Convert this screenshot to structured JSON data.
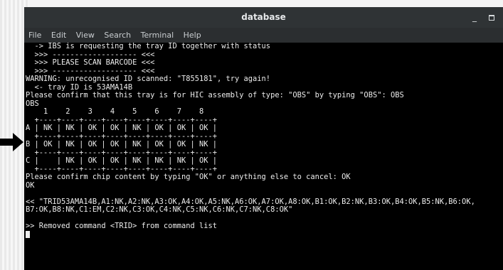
{
  "window": {
    "title": "database",
    "minimize_glyph": "_",
    "maximize_icon": "maximize-icon"
  },
  "menu": {
    "items": [
      "File",
      "Edit",
      "View",
      "Search",
      "Terminal",
      "Help"
    ]
  },
  "terminal": {
    "lines": [
      "  -> IBS is requesting the tray ID together with status",
      "  >>> ------------------- <<<",
      "  >>> PLEASE SCAN BARCODE <<<",
      "  >>> ------------------- <<<",
      "WARNING: unrecognised ID scanned: \"T855181\", try again!",
      "  <- tray ID is 53AMA14B",
      "Please confirm that this tray is for HIC assembly of type: \"OBS\" by typing \"OBS\": OBS",
      "OBS",
      "    1    2    3    4    5    6    7    8",
      "  +----+----+----+----+----+----+----+----+",
      "A | NK | NK | OK | OK | NK | OK | OK | OK |",
      "  +----+----+----+----+----+----+----+----+",
      "B | OK | NK | OK | OK | NK | OK | OK | NK |",
      "  +----+----+----+----+----+----+----+----+",
      "C |    | NK | OK | OK | NK | NK | NK | OK |",
      "  +----+----+----+----+----+----+----+----+",
      "Please confirm chip content by typing \"OK\" or anything else to cancel: OK",
      "OK",
      "",
      "<< \"TRID53AMA14B,A1:NK,A2:NK,A3:OK,A4:OK,A5:NK,A6:OK,A7:OK,A8:OK,B1:OK,B2:NK,B3:OK,B4:OK,B5:NK,B6:OK,",
      "B7:OK,B8:NK,C1:EM,C2:NK,C3:OK,C4:NK,C5:NK,C6:NK,C7:NK,C8:OK\"",
      "",
      ">> Removed command <TRID> from command list"
    ]
  },
  "colors": {
    "terminal_bg": "#000000",
    "terminal_fg": "#ececec",
    "titlebar_bg": "#2f3335",
    "menubar_bg": "#2b2e30"
  }
}
